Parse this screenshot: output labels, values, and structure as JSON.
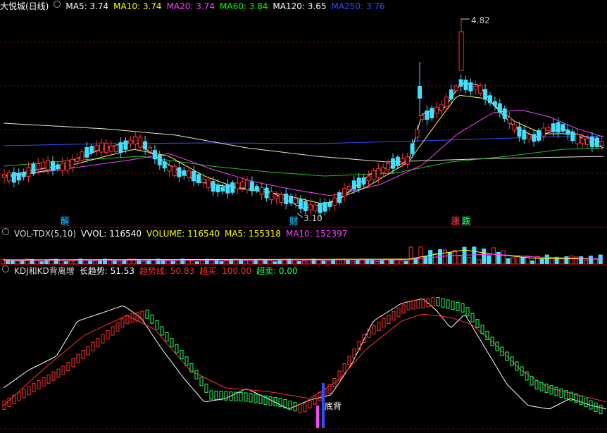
{
  "price": {
    "title": "大悦城(日线)",
    "ma": [
      {
        "label": "MA5: 3.74",
        "color": "#ffffff"
      },
      {
        "label": "MA10: 3.74",
        "color": "#ffff00"
      },
      {
        "label": "MA20: 3.74",
        "color": "#ff40ff"
      },
      {
        "label": "MA60: 3.84",
        "color": "#00ff00"
      },
      {
        "label": "MA120: 3.65",
        "color": "#ffffff"
      },
      {
        "label": "MA250: 3.76",
        "color": "#3050ff"
      }
    ],
    "high_label": "4.82",
    "low_label": "3.10",
    "signals": [
      {
        "text": "解",
        "color": "#00c0ff"
      },
      {
        "text": "财",
        "color": "#00c0ff"
      },
      {
        "text": "涨",
        "color": "#ff4040"
      },
      {
        "text": "跌",
        "color": "#20ff60"
      }
    ]
  },
  "volume": {
    "title": "VOL-TDX(5,10)",
    "items": [
      {
        "label": "VVOL: 116540",
        "color": "#ffffff"
      },
      {
        "label": "VOLUME: 116540",
        "color": "#ffff00"
      },
      {
        "label": "MA5: 155318",
        "color": "#ffff00"
      },
      {
        "label": "MA10: 152397",
        "color": "#ff40ff"
      }
    ]
  },
  "kdj": {
    "title": "KDJ和KD背离增",
    "items": [
      {
        "label": "长趋势: 51.53",
        "color": "#ffffff"
      },
      {
        "label": "趋势线: 50.83",
        "color": "#ff3030"
      },
      {
        "label": "超买: 100.00",
        "color": "#ff3030"
      },
      {
        "label": "超卖: 0.00",
        "color": "#20ff60"
      }
    ],
    "divergence_label": "底背"
  }
}
